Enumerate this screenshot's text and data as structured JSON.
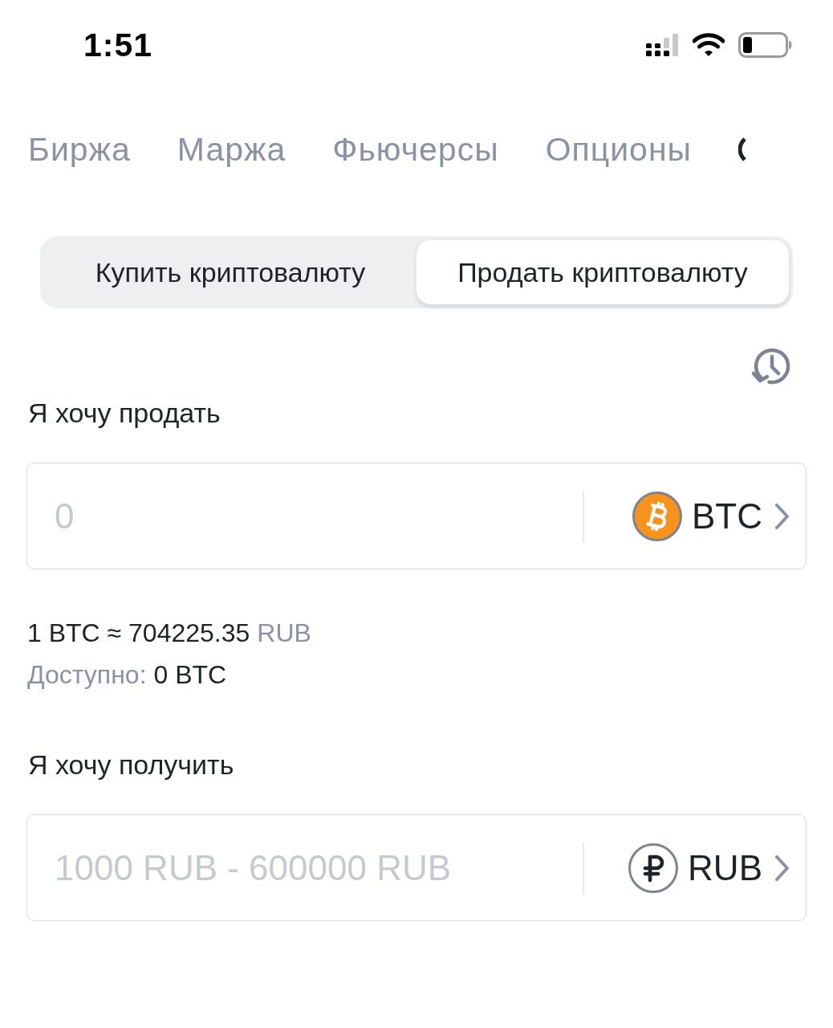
{
  "status_bar": {
    "time": "1:51"
  },
  "tabs": [
    {
      "kind": "text",
      "label": "Биржа",
      "selected": false
    },
    {
      "kind": "text",
      "label": "Маржа",
      "selected": false
    },
    {
      "kind": "text",
      "label": "Фьючерсы",
      "selected": false
    },
    {
      "kind": "text",
      "label": "Опционы",
      "selected": false
    },
    {
      "kind": "clipped",
      "selected": true
    }
  ],
  "trade_toggle": [
    {
      "label": "Купить криптовалюту",
      "selected": false
    },
    {
      "label": "Продать криптовалюту",
      "selected": true
    }
  ],
  "sell": {
    "label": "Я хочу продать",
    "placeholder": "0",
    "currency": {
      "kind": "bitcoin",
      "code": "BTC"
    }
  },
  "rate": {
    "value": "1 BTC ≈ 704225.35",
    "unit": "RUB"
  },
  "available": {
    "label": "Доступно:",
    "value": "0 BTC"
  },
  "receive": {
    "label": "Я хочу получить",
    "placeholder": "1000 RUB - 600000 RUB",
    "currency": {
      "kind": "ruble",
      "code": "RUB"
    }
  }
}
